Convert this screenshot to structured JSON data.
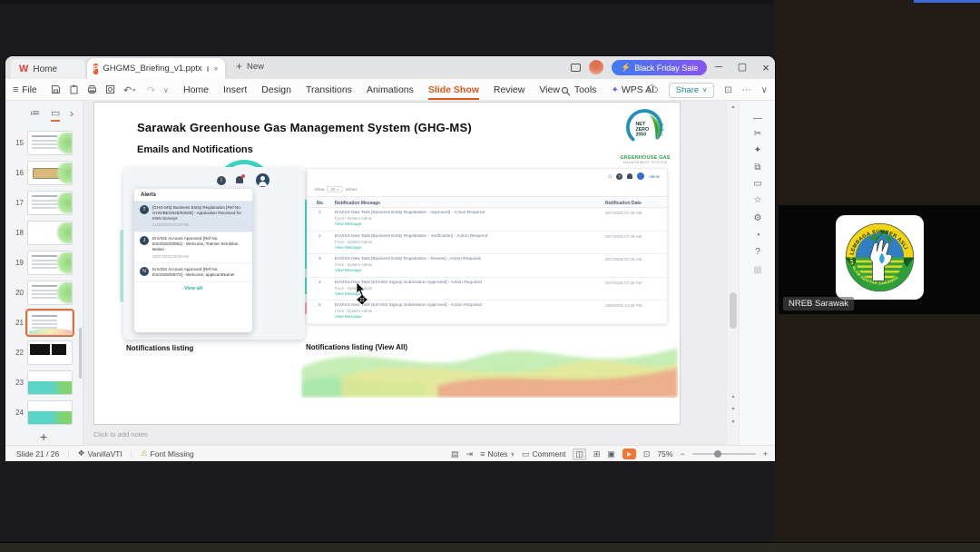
{
  "titlebar": {
    "home_tab": "Home",
    "doc_tab": "GHGMS_Briefing_v1.pptx",
    "new_tab": "New",
    "promo": "Black Friday Sale"
  },
  "ribbon": {
    "file": "File",
    "menus": [
      "Home",
      "Insert",
      "Design",
      "Transitions",
      "Animations",
      "Slide Show",
      "Review",
      "View",
      "Tools",
      "WPS AI"
    ],
    "active_menu": "Slide Show",
    "share": "Share"
  },
  "thumbnail_panel": {
    "selected": "21",
    "slides": [
      {
        "num": "15",
        "variant": "lines"
      },
      {
        "num": "16",
        "variant": "tanbox"
      },
      {
        "num": "17",
        "variant": "lines"
      },
      {
        "num": "18",
        "variant": "plain"
      },
      {
        "num": "19",
        "variant": "lines"
      },
      {
        "num": "20",
        "variant": "lines"
      },
      {
        "num": "21",
        "variant": "current"
      },
      {
        "num": "22",
        "variant": "dark"
      },
      {
        "num": "23",
        "variant": "wave"
      },
      {
        "num": "24",
        "variant": "wave"
      }
    ]
  },
  "slide": {
    "title": "Sarawak Greenhouse Gas Management System (GHG-MS)",
    "subtitle": "Emails and Notifications",
    "logo": {
      "badge_lines": [
        "NET",
        "ZERO",
        "2050"
      ],
      "line1": "GREENHOUSE GAS",
      "line2": "MANAGEMENT SYSTEM"
    },
    "alerts": {
      "header": "Alerts",
      "items": [
        {
          "initial": "T",
          "text": "[GHG-MS] Business Entity Registration [Ref No. GHG/BE/2025/00028] - Application Received for KNN Surveys",
          "date": "21/10/2025 02:19 PM",
          "highlight": true
        },
        {
          "initial": "J",
          "text": "EnVISS Account Approved [Ref No. ES/2025/00081] - Welcome, Trainee Sembilan Belas!",
          "date": "30/07/2025 09:09 AM",
          "highlight": false
        },
        {
          "initial": "N",
          "text": "EnVISS Account Approved [Ref No. ES/2025/00072] - Welcome, applicantName!",
          "date": "",
          "highlight": false
        }
      ],
      "view_all": "View all"
    },
    "listing": {
      "show_label": "Show",
      "show_value": "10",
      "entries_label": "entries",
      "user_label": "Admin",
      "headers": [
        "No.",
        "Notification Message",
        "Notification Date"
      ],
      "rows": [
        {
          "no": "1",
          "message": "EnVISS New Task [Business Entity Registration - Approved] - Action Required",
          "from": "From : System Admin",
          "link": "View Message",
          "date": "30/7/2025 07:49 AM"
        },
        {
          "no": "2",
          "message": "EnVISS New Task [Business Entity Registration - Verification] - Action Required",
          "from": "From : System Admin",
          "link": "View Message",
          "date": "30/7/2025 07:49 AM"
        },
        {
          "no": "3",
          "message": "EnVISS New Task [Business Entity Registration - Review] - Action Required",
          "from": "From : System Admin",
          "link": "View Message",
          "date": "30/7/2025 07:46 AM"
        },
        {
          "no": "4",
          "message": "EnVISS New Task [EnVISS Signup Submission Approved] - Action Required",
          "from": "From : System Admin",
          "link": "View Message",
          "date": "30/7/2025 07:30 AM"
        },
        {
          "no": "5",
          "message": "EnVISS New Task [EnVISS Signup Submission Approved] - Action Required",
          "from": "From : System Admin",
          "link": "View Message",
          "date": "18/6/2025 12:56 PM"
        }
      ]
    },
    "caption_left": "Notifications listing",
    "caption_right": "Notifications listing (View All)"
  },
  "notes_placeholder": "Click to add notes",
  "statusbar": {
    "slide_counter": "Slide 21 / 26",
    "theme_name": "VanillaVTI",
    "font_missing": "Font Missing",
    "notes_label": "Notes",
    "comment_label": "Comment",
    "zoom_level": "75%"
  },
  "meeting": {
    "participant_name": "NREB Sarawak",
    "logo_top_text": "LEMBAGA SUMBER ASLI",
    "logo_bottom_text": "DAN ALAM SEKITAR SARAWAK"
  },
  "colors": {
    "accent_orange": "#d85b1a",
    "promo_start": "#3f7bf5",
    "promo_end": "#8655f0",
    "teal_link": "#2ab3a6",
    "selection_border": "#e0703a"
  }
}
